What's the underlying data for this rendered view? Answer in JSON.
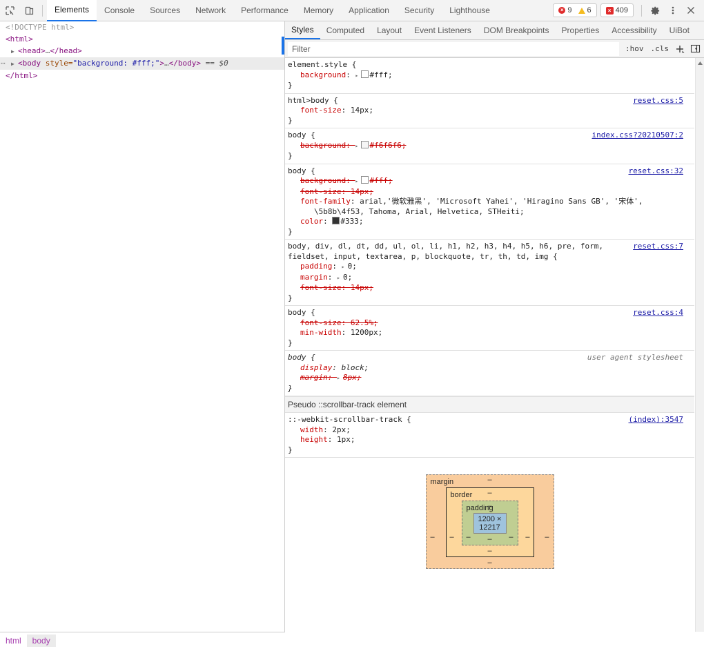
{
  "toolbar": {
    "inspect_icon": "inspect-element-icon",
    "device_icon": "device-toolbar-icon",
    "tabs": [
      {
        "label": "Elements",
        "active": true
      },
      {
        "label": "Console",
        "active": false
      },
      {
        "label": "Sources",
        "active": false
      },
      {
        "label": "Network",
        "active": false
      },
      {
        "label": "Performance",
        "active": false
      },
      {
        "label": "Memory",
        "active": false
      },
      {
        "label": "Application",
        "active": false
      },
      {
        "label": "Security",
        "active": false
      },
      {
        "label": "Lighthouse",
        "active": false
      }
    ],
    "errors_count": "9",
    "warnings_count": "6",
    "issues_count": "409",
    "settings_icon": "gear-icon",
    "more_icon": "kebab-menu-icon",
    "close_icon": "close-icon"
  },
  "dom_tree": {
    "lines": [
      {
        "type": "doctype",
        "text": "<!DOCTYPE html>"
      },
      {
        "type": "tag_open",
        "text": "<html>"
      },
      {
        "type": "collapsed",
        "twisty": "▶",
        "tag_start": "<head>",
        "ellipsis": "…",
        "tag_end": "</head>"
      },
      {
        "type": "selected",
        "twisty": "▶",
        "tag_name": "<body",
        "attr_name": "style",
        "attr_value": "\"background: #fff;\"",
        "gt": ">",
        "ellipsis": "…",
        "tag_end": "</body>",
        "marker": "== $0"
      },
      {
        "type": "tag_close",
        "text": "</html>"
      }
    ]
  },
  "crumbs": [
    {
      "label": "html",
      "active": false
    },
    {
      "label": "body",
      "active": true
    }
  ],
  "styles_panel": {
    "tabs": [
      {
        "label": "Styles",
        "active": true
      },
      {
        "label": "Computed",
        "active": false
      },
      {
        "label": "Layout",
        "active": false
      },
      {
        "label": "Event Listeners",
        "active": false
      },
      {
        "label": "DOM Breakpoints",
        "active": false
      },
      {
        "label": "Properties",
        "active": false
      },
      {
        "label": "Accessibility",
        "active": false
      },
      {
        "label": "UiBot",
        "active": false
      }
    ],
    "filter_placeholder": "Filter",
    "filter_value": "",
    "hov_label": ":hov",
    "cls_label": ".cls",
    "new_rule_label": "+",
    "sidebar_toggle_icon": "toggle-sidebar-icon",
    "rules": [
      {
        "selector": "element.style {",
        "origin": "",
        "origin_kind": "none",
        "declarations": [
          {
            "expander": "▸",
            "swatch": "#ffffff",
            "prop": "background",
            "value": "#fff",
            "strike": false
          }
        ],
        "close": "}"
      },
      {
        "selector": "html>body {",
        "origin": "reset.css:5",
        "origin_kind": "link",
        "declarations": [
          {
            "expander": "",
            "swatch": "",
            "prop": "font-size",
            "value": "14px",
            "strike": false
          }
        ],
        "close": "}"
      },
      {
        "selector": "body {",
        "origin": "index.css?20210507:2",
        "origin_kind": "link",
        "declarations": [
          {
            "expander": "▸",
            "swatch": "#f6f6f6",
            "prop": "background",
            "value": "#f6f6f6",
            "strike": true
          }
        ],
        "close": "}"
      },
      {
        "selector": "body {",
        "origin": "reset.css:32",
        "origin_kind": "link",
        "declarations": [
          {
            "expander": "▸",
            "swatch": "#ffffff",
            "prop": "background",
            "value": "#fff",
            "strike": true
          },
          {
            "expander": "",
            "swatch": "",
            "prop": "font-size",
            "value": "14px",
            "strike": true
          },
          {
            "expander": "",
            "swatch": "",
            "prop": "font-family",
            "value": "arial,'微软雅黑', 'Microsoft Yahei', 'Hiragino Sans GB', '宋体',",
            "continuation": "\\5b8b\\4f53, Tahoma, Arial, Helvetica, STHeiti;",
            "strike": false
          },
          {
            "expander": "",
            "swatch": "#333333",
            "prop": "color",
            "value": "#333",
            "strike": false
          }
        ],
        "close": "}"
      },
      {
        "selector": "body, div, dl, dt, dd, ul, ol, li, h1, h2, h3, h4, h5, h6, pre, form,",
        "selector_line2": "fieldset, input, textarea, p, blockquote, tr, th, td, img {",
        "origin": "reset.css:7",
        "origin_kind": "link",
        "declarations": [
          {
            "expander": "▸",
            "swatch": "",
            "prop": "padding",
            "value": "0",
            "strike": false
          },
          {
            "expander": "▸",
            "swatch": "",
            "prop": "margin",
            "value": "0",
            "strike": false
          },
          {
            "expander": "",
            "swatch": "",
            "prop": "font-size",
            "value": "14px",
            "strike": true
          }
        ],
        "close": "}"
      },
      {
        "selector": "body {",
        "origin": "reset.css:4",
        "origin_kind": "link",
        "declarations": [
          {
            "expander": "",
            "swatch": "",
            "prop": "font-size",
            "value": "62.5%",
            "strike": true
          },
          {
            "expander": "",
            "swatch": "",
            "prop": "min-width",
            "value": "1200px",
            "strike": false
          }
        ],
        "close": "}"
      },
      {
        "selector": "body {",
        "origin": "user agent stylesheet",
        "origin_kind": "ua",
        "ua": true,
        "declarations": [
          {
            "expander": "",
            "swatch": "",
            "prop": "display",
            "value": "block",
            "strike": false
          },
          {
            "expander": "▸",
            "swatch": "",
            "prop": "margin",
            "value": "8px",
            "strike": true
          }
        ],
        "close": "}"
      }
    ],
    "pseudo_header": "Pseudo ::scrollbar-track element",
    "pseudo_rules": [
      {
        "selector": "::-webkit-scrollbar-track {",
        "origin": "(index):3547",
        "origin_kind": "link",
        "declarations": [
          {
            "expander": "",
            "swatch": "",
            "prop": "width",
            "value": "2px",
            "strike": false
          },
          {
            "expander": "",
            "swatch": "",
            "prop": "height",
            "value": "1px",
            "strike": false
          }
        ],
        "close": "}"
      }
    ]
  },
  "box_model": {
    "margin_label": "margin",
    "border_label": "border",
    "padding_label": "padding",
    "content_size": "1200 × 12217",
    "dash": "–",
    "colors": {
      "margin": "#f9cc9d",
      "border": "#fdd79c",
      "padding": "#c0ce92",
      "content": "#9fc3dd"
    }
  }
}
